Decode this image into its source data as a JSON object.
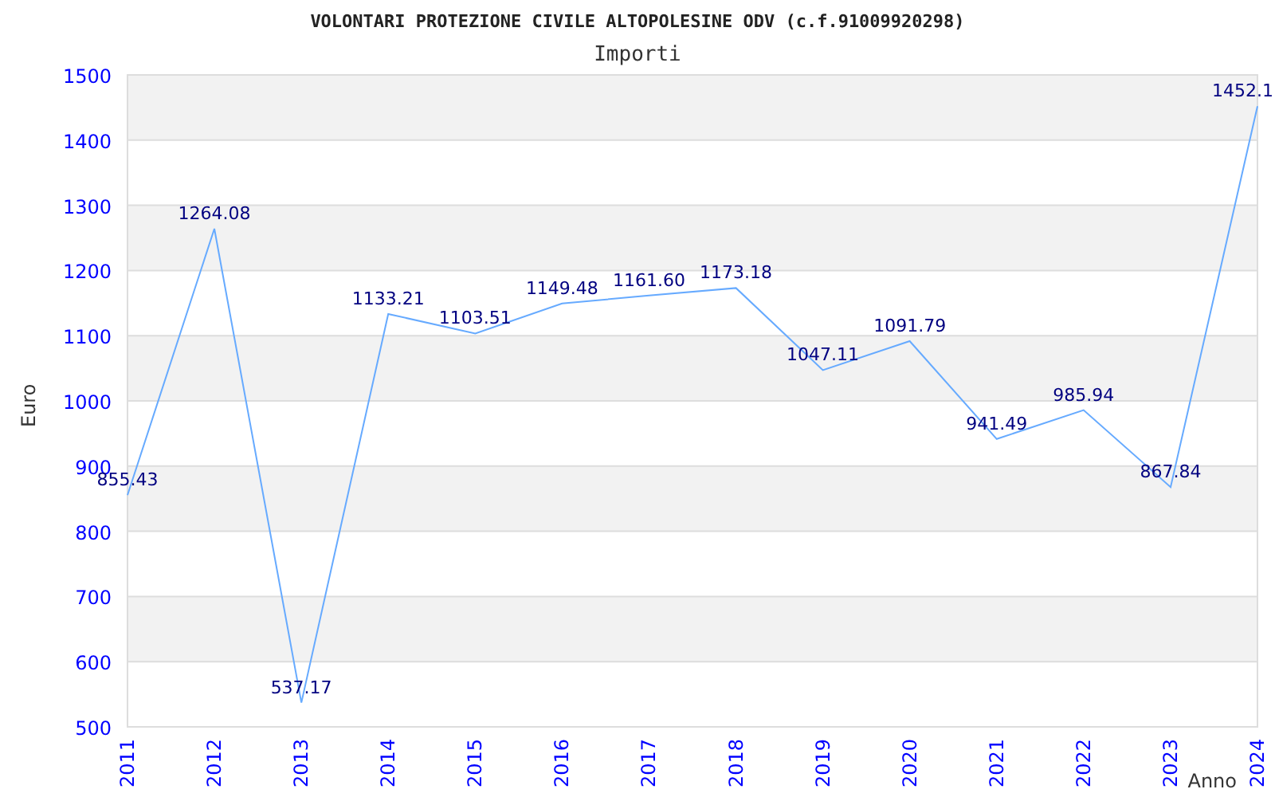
{
  "title": "VOLONTARI PROTEZIONE CIVILE ALTOPOLESINE ODV (c.f.91009920298)",
  "chart_data": {
    "type": "line",
    "grid": true,
    "xlabel": "Anno",
    "ylabel": "Euro",
    "categories": [
      "2011",
      "2012",
      "2013",
      "2014",
      "2015",
      "2016",
      "2017",
      "2018",
      "2019",
      "2020",
      "2021",
      "2022",
      "2023",
      "2024"
    ],
    "series": [
      {
        "name": "Importi",
        "color": "#66aaff",
        "values": [
          855.43,
          1264.08,
          537.17,
          1133.21,
          1103.51,
          1149.48,
          1161.6,
          1173.18,
          1047.11,
          1091.79,
          941.49,
          985.94,
          867.84,
          1452.1
        ]
      }
    ],
    "ylim": [
      500,
      1500
    ],
    "yticks": [
      500,
      600,
      700,
      800,
      900,
      1000,
      1100,
      1200,
      1300,
      1400,
      1500
    ],
    "value_labels": [
      "855.43",
      "1264.08",
      "537.17",
      "1133.21",
      "1103.51",
      "1149.48",
      "1161.60",
      "1173.18",
      "1047.11",
      "1091.79",
      "941.49",
      "985.94",
      "867.84",
      "1452.1"
    ]
  }
}
